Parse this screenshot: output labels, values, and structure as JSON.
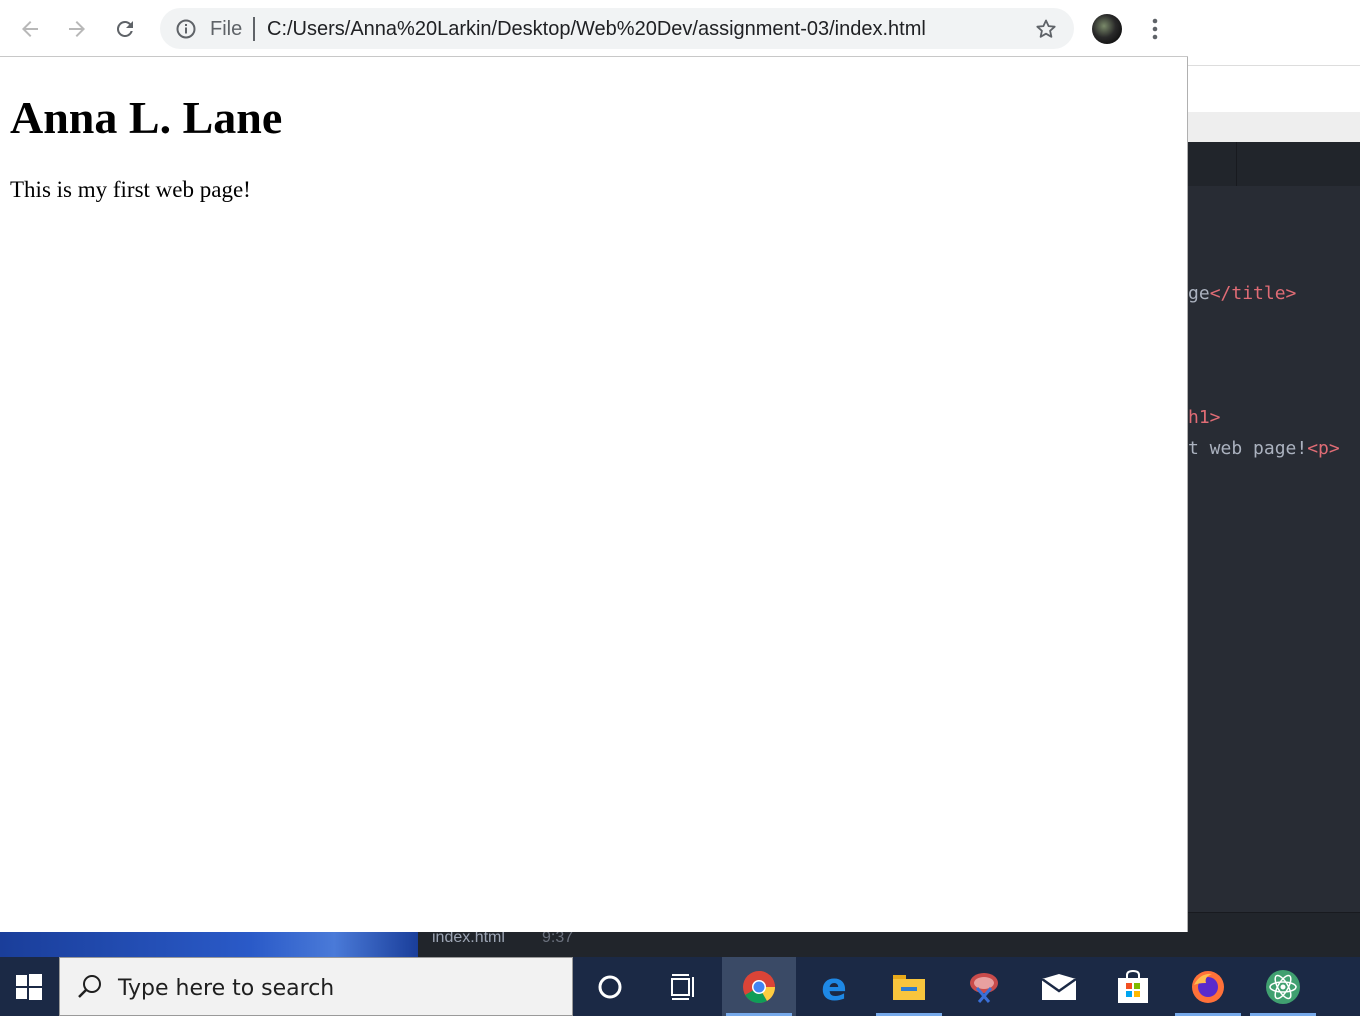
{
  "browser": {
    "url_scheme": "File",
    "url": "C:/Users/Anna%20Larkin/Desktop/Web%20Dev/assignment-03/index.html",
    "icons": {
      "back": "arrow-left-icon",
      "forward": "arrow-right-icon",
      "reload": "reload-icon",
      "info": "info-icon",
      "star": "star-icon",
      "menu": "three-dots-icon"
    }
  },
  "page": {
    "heading": "Anna L. Lane",
    "paragraph": "This is my first web page!"
  },
  "editor": {
    "lines": [
      {
        "text": "ge",
        "tag": "</title>"
      },
      {
        "text": "",
        "tag": "h1>"
      },
      {
        "text": "t web page!",
        "tag": "<p>"
      }
    ],
    "status_file": "index.html",
    "status_pos": "9:37"
  },
  "taskbar": {
    "search_placeholder": "Type here to search",
    "apps": [
      "cortana",
      "task-view",
      "chrome",
      "edge",
      "file-explorer",
      "snipping-tool",
      "mail",
      "store",
      "firefox",
      "atom"
    ],
    "active_app": "chrome",
    "colors": {
      "taskbar": "#1b2945",
      "indicator": "#76a9ea"
    }
  }
}
